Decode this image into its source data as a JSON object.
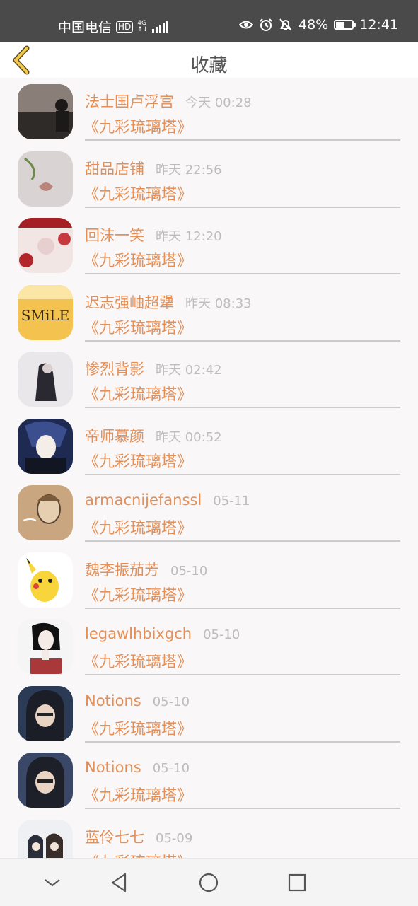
{
  "status_bar": {
    "carrier": "中国电信",
    "hd_badge": "HD",
    "network_type": "4G",
    "network_sub": "↑↓",
    "battery_percent": "48%",
    "battery_level": 0.48,
    "time": "12:41",
    "icons": [
      "eye-icon",
      "alarm-icon",
      "mute-bell-icon",
      "battery-icon"
    ]
  },
  "header": {
    "title": "收藏",
    "back_icon": "chevron-left-icon"
  },
  "accent_color": "#e58f56",
  "items": [
    {
      "name": "法士国卢浮宫",
      "time": "今天 00:28",
      "book": "《九彩琉璃塔》"
    },
    {
      "name": "甜品店铺",
      "time": "昨天 22:56",
      "book": "《九彩琉璃塔》"
    },
    {
      "name": "回沫一笑",
      "time": "昨天 12:20",
      "book": "《九彩琉璃塔》"
    },
    {
      "name": "迟志强岫超犟",
      "time": "昨天 08:33",
      "book": "《九彩琉璃塔》"
    },
    {
      "name": "惨烈背影",
      "time": "昨天 02:42",
      "book": "《九彩琉璃塔》"
    },
    {
      "name": "帝师慕颜",
      "time": "昨天 00:52",
      "book": "《九彩琉璃塔》"
    },
    {
      "name": "armacnijefanssl",
      "time": "05-11",
      "book": "《九彩琉璃塔》"
    },
    {
      "name": "魏李振茄芳",
      "time": "05-10",
      "book": "《九彩琉璃塔》"
    },
    {
      "name": "legawlhbixgch",
      "time": "05-10",
      "book": "《九彩琉璃塔》"
    },
    {
      "name": "Notions",
      "time": "05-10",
      "book": "《九彩琉璃塔》"
    },
    {
      "name": "Notions",
      "time": "05-10",
      "book": "《九彩琉璃塔》"
    },
    {
      "name": "蓝伶七七",
      "time": "05-09",
      "book": "《九彩琉璃塔》"
    }
  ],
  "avatar_smile_text": "SMiLE",
  "nav_bar": {
    "icons": [
      "collapse-down-icon",
      "back-triangle-icon",
      "home-circle-icon",
      "recents-square-icon"
    ]
  }
}
